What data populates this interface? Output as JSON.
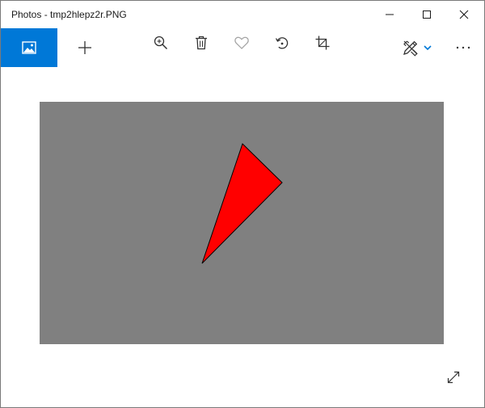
{
  "window": {
    "title": "Photos - tmp2hlepz2r.PNG",
    "controls": {
      "minimize_icon": "minimize-icon",
      "maximize_icon": "maximize-icon",
      "close_icon": "close-icon"
    }
  },
  "toolbar": {
    "items": [
      {
        "icon": "photo-view-icon",
        "active": true
      },
      {
        "icon": "plus-icon"
      },
      {
        "icon": "zoom-in-icon"
      },
      {
        "icon": "trash-icon"
      },
      {
        "icon": "heart-icon"
      },
      {
        "icon": "rotate-icon"
      },
      {
        "icon": "crop-icon"
      },
      {
        "icon": "edit-draw-icon"
      },
      {
        "icon": "chevron-down-icon"
      },
      {
        "icon": "more-icon"
      }
    ],
    "more_label": "···"
  },
  "image": {
    "background_color": "#808080",
    "triangle_color": "#ff0000",
    "outline_color": "#000000"
  },
  "colors": {
    "accent": "#0078d7",
    "icon": "#333333",
    "heart_disabled": "#a0a0a0"
  }
}
